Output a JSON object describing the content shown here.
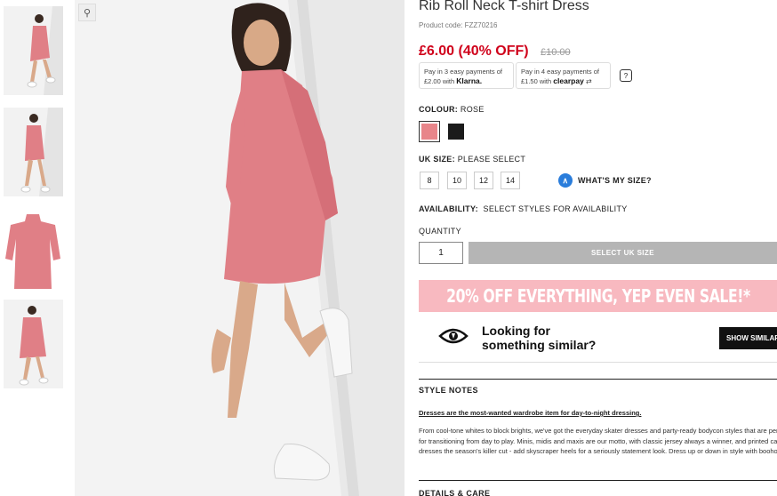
{
  "product": {
    "title": "Rib Roll Neck T-shirt Dress",
    "code": "Product code: FZZ70216",
    "price": "£6.00 (40% OFF)",
    "old_price": "£10.00"
  },
  "payments": {
    "klarna_line1": "Pay in 3 easy payments of",
    "klarna_amount": "£2.00 with",
    "klarna_brand": "Klarna.",
    "clearpay_line1": "Pay in 4 easy payments of",
    "clearpay_amount": "£1.50 with",
    "clearpay_brand": "clearpay",
    "help": "?"
  },
  "colour": {
    "label": "COLOUR:",
    "value": "ROSE",
    "swatches": [
      {
        "name": "Rose",
        "hex": "#e8858a"
      },
      {
        "name": "Black",
        "hex": "#1b1b1b"
      }
    ]
  },
  "size": {
    "label": "UK SIZE:",
    "value": "PLEASE SELECT",
    "options": [
      "8",
      "10",
      "12",
      "14"
    ],
    "guide": "WHAT'S MY SIZE?"
  },
  "availability": {
    "label": "AVAILABILITY:",
    "value": "SELECT STYLES FOR AVAILABILITY"
  },
  "quantity": {
    "label": "QUANTITY",
    "value": "1",
    "button": "SELECT UK SIZE"
  },
  "promo": {
    "text": "20% OFF EVERYTHING, YEP EVEN SALE!*"
  },
  "similar": {
    "line1": "Looking for",
    "line2": "something similar?",
    "button": "SHOW SIMILAR"
  },
  "style_notes": {
    "heading": "STYLE NOTES",
    "link": "Dresses are the most-wanted wardrobe item for day-to-night dressing.",
    "body": "From cool-tone whites to block brights, we've got the everyday skater dresses and party-ready bodycon styles that are perfect for transitioning from day to play. Minis, midis and maxis are our motto, with classic jersey always a winner, and printed cami dresses the season's killer cut - add skyscraper heels for a seriously statement look. Dress up or down in style with boohoo."
  },
  "details": {
    "heading": "DETAILS & CARE"
  },
  "colors": {
    "accent": "#d0021b",
    "dress": "#e07f86",
    "promo_bg": "#f8b9c0"
  }
}
